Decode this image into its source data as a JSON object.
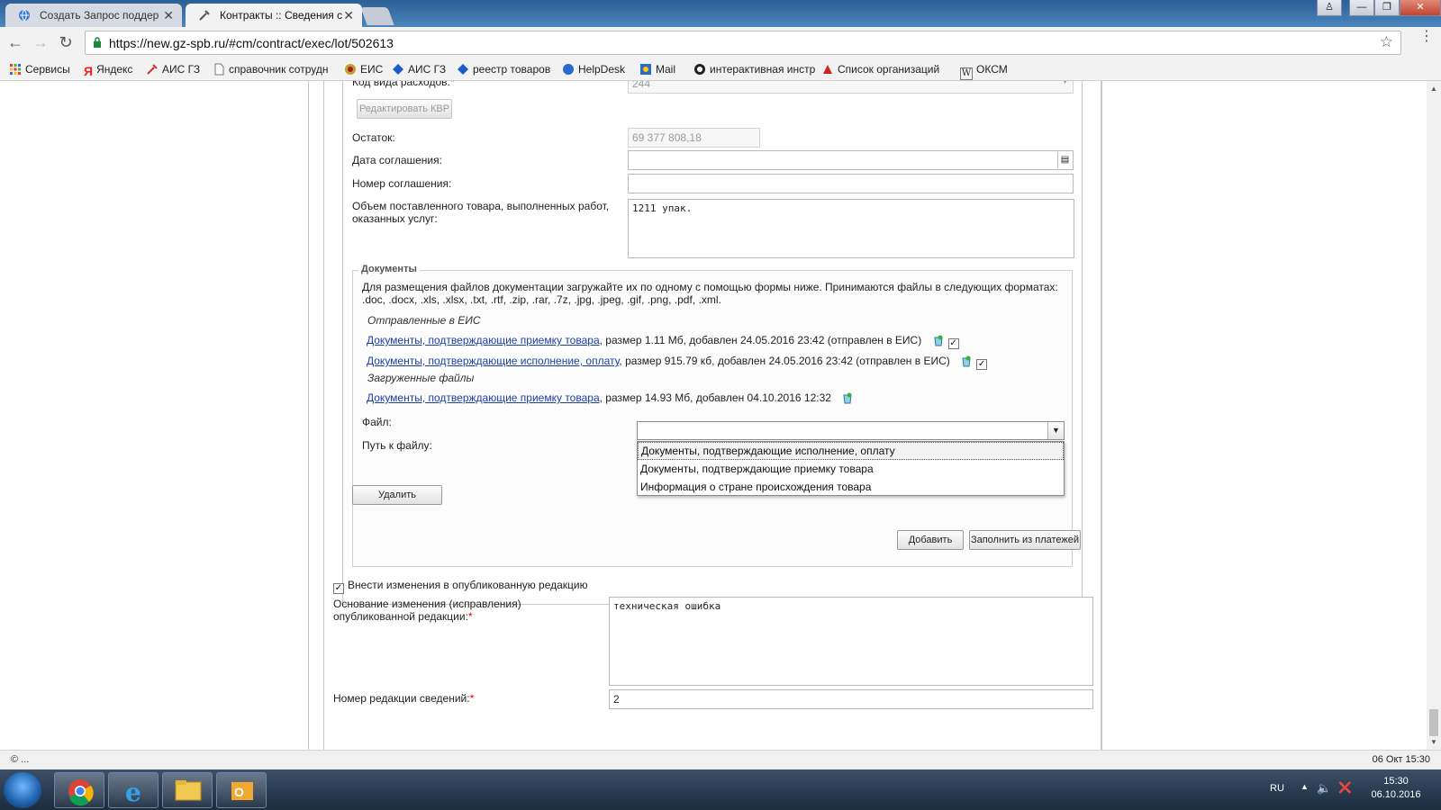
{
  "tabs": [
    {
      "title": "Создать Запрос поддер",
      "active": false
    },
    {
      "title": "Контракты :: Сведения с",
      "active": true
    }
  ],
  "address_bar": {
    "url": "https://new.gz-spb.ru/#cm/contract/exec/lot/502613"
  },
  "bookmarks": [
    {
      "label": "Сервисы"
    },
    {
      "label": "Яндекс"
    },
    {
      "label": "АИС ГЗ"
    },
    {
      "label": "справочник сотрудн"
    },
    {
      "label": "ЕИС"
    },
    {
      "label": "АИС ГЗ"
    },
    {
      "label": "реестр товаров"
    },
    {
      "label": "HelpDesk"
    },
    {
      "label": "Mail"
    },
    {
      "label": "интерактивная инстр"
    },
    {
      "label": "Список организаций"
    },
    {
      "label": "ОКСМ"
    }
  ],
  "form": {
    "kvr_label": "Код вида расходов:",
    "kvr_value": "244",
    "edit_kvr_button": "Редактировать КВР",
    "remainder_label": "Остаток:",
    "remainder_value": "69 377 808,18",
    "agreement_date_label": "Дата соглашения:",
    "agreement_date_value": "",
    "agreement_number_label": "Номер соглашения:",
    "agreement_number_value": "",
    "volume_label_1": "Объем поставленного товара, выполненных работ,",
    "volume_label_2": "оказанных услуг:",
    "volume_value": "1211 упак."
  },
  "documents": {
    "legend": "Документы",
    "info_line_1": "Для размещения файлов документации загружайте их по одному с помощью формы ниже. Принимаются файлы в следующих форматах:",
    "info_line_2": ".doc, .docx, .xls, .xlsx, .txt, .rtf, .zip, .rar, .7z, .jpg, .jpeg, .gif, .png, .pdf, .xml.",
    "sent_header": "Отправленные в ЕИС",
    "sent": [
      {
        "link": "Документы, подтверждающие приемку товара",
        "info": ", размер 1.11 Мб, добавлен 24.05.2016 23:42 (отправлен в ЕИС)"
      },
      {
        "link": "Документы, подтверждающие исполнение, оплату",
        "info": ", размер 915.79 кб, добавлен 24.05.2016 23:42 (отправлен в ЕИС)"
      }
    ],
    "uploaded_header": "Загруженные файлы",
    "uploaded": [
      {
        "link": "Документы, подтверждающие приемку товара",
        "info": ", размер 14.93 Мб, добавлен 04.10.2016 12:32"
      }
    ],
    "file_label": "Файл:",
    "path_label": "Путь к файлу:",
    "dropdown_options": [
      "Документы, подтверждающие исполнение, оплату",
      "Документы, подтверждающие приемку товара",
      "Информация о стране происхождения товара"
    ],
    "delete_button": "Удалить"
  },
  "actions": {
    "add_button": "Добавить",
    "fill_button": "Заполнить из платежей"
  },
  "revision": {
    "apply_changes_label": "Внести изменения в опубликованную редакцию",
    "apply_changes_checked": true,
    "reason_label_1": "Основание изменения (исправления)",
    "reason_label_2": "опубликованной редакции:",
    "reason_value": "техническая ошибка",
    "number_label": "Номер редакции сведений:",
    "number_value": "2"
  },
  "statusbar": {
    "left": "© ...",
    "right": "06 Окт 15:30"
  },
  "taskbar": {
    "lang": "RU",
    "time": "15:30",
    "date": "06.10.2016"
  }
}
